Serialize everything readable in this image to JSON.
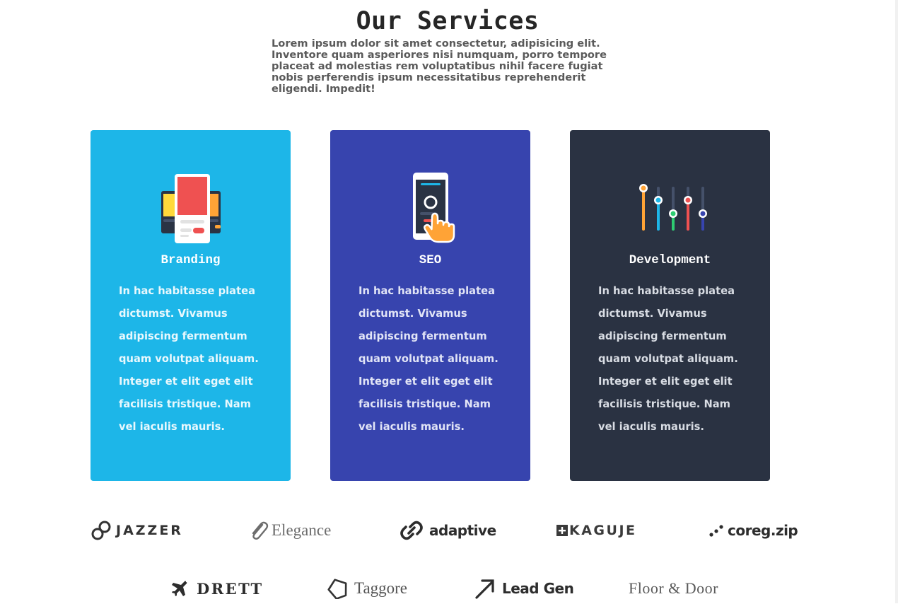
{
  "header": {
    "title": "Our Services",
    "intro": "Lorem ipsum dolor sit amet consectetur, adipisicing elit. Inventore quam asperiores nisi numquam, porro tempore placeat ad molestias rem voluptatibus nihil facere fugiat nobis perferendis ipsum necessitatibus reprehenderit eligendi. Impedit!"
  },
  "services": [
    {
      "title": "Branding",
      "icon": "devices-icon",
      "color": "#1db6e8",
      "body": "In hac habitasse platea dictumst. Vivamus adipiscing fermentum quam volutpat aliquam. Integer et elit eget elit facilisis tristique. Nam vel iaculis mauris."
    },
    {
      "title": "SEO",
      "icon": "phone-touch-icon",
      "color": "#3744ae",
      "body": "In hac habitasse platea dictumst. Vivamus adipiscing fermentum quam volutpat aliquam. Integer et elit eget elit facilisis tristique. Nam vel iaculis mauris."
    },
    {
      "title": "Development",
      "icon": "sliders-icon",
      "color": "#2a3242",
      "body": "In hac habitasse platea dictumst. Vivamus adipiscing fermentum quam volutpat aliquam. Integer et elit eget elit facilisis tristique. Nam vel iaculis mauris."
    }
  ],
  "clients": [
    {
      "name": "JAZZER",
      "icon": "chain-link-icon"
    },
    {
      "name": "Elegance",
      "icon": "paperclip-icon"
    },
    {
      "name": "adaptive",
      "icon": "link-icon"
    },
    {
      "name": "KAGUJE",
      "icon": "plus-square-icon"
    },
    {
      "name": "coreg.zip",
      "icon": "dots-icon"
    },
    {
      "name": "DRETT",
      "icon": "airplane-icon"
    },
    {
      "name": "Taggore",
      "icon": "tag-icon"
    },
    {
      "name": "Lead Gen",
      "icon": "arrow-up-right-icon"
    },
    {
      "name": "Floor & Door",
      "icon": ""
    }
  ]
}
